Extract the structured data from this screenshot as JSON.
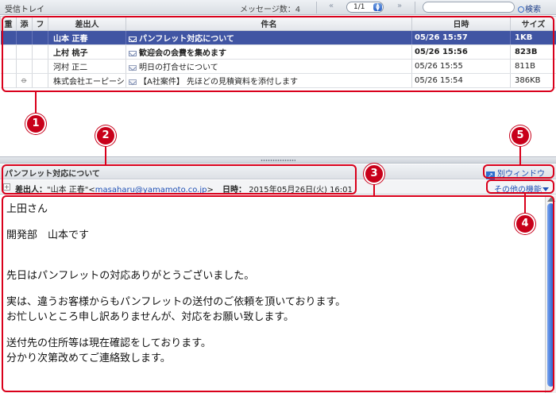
{
  "toolbar": {
    "title": "受信トレイ",
    "message_count": "メッセージ数：4",
    "page_prev": "«",
    "page_current": "1/1",
    "page_next": "»",
    "search_label": "検索",
    "search_placeholder": ""
  },
  "list": {
    "columns": [
      "重",
      "添",
      "フ",
      "差出人",
      "件名",
      "日時",
      "サイズ"
    ],
    "rows": [
      {
        "important": "",
        "attachment": false,
        "flag": "",
        "sender": "山本 正春",
        "subject": "パンフレット対応について",
        "date": "05/26 15:57",
        "size": "1KB",
        "state": "selected",
        "envelope": "read"
      },
      {
        "important": "",
        "attachment": false,
        "flag": "",
        "sender": "上村 桃子",
        "subject": "歓迎会の会費を集めます",
        "date": "05/26 15:56",
        "size": "823B",
        "state": "unread",
        "envelope": "unread"
      },
      {
        "important": "",
        "attachment": false,
        "flag": "",
        "sender": "河村 正二",
        "subject": "明日の打合せについて",
        "date": "05/26 15:55",
        "size": "811B",
        "state": "read",
        "envelope": "read"
      },
      {
        "important": "",
        "attachment": true,
        "flag": "",
        "sender": "株式会社エーピーシ",
        "subject": "【A社案件】 先ほどの見積資料を添付します",
        "date": "05/26 15:54",
        "size": "386KB",
        "state": "read",
        "envelope": "read"
      }
    ]
  },
  "preview": {
    "subject": "パンフレット対応について",
    "popout_label": "別ウィンドウ",
    "popout_icon": "popout-icon",
    "from_label": "差出人：",
    "from_name": "\"山本 正春\"",
    "from_email": "masaharu@yamamoto.co.jp",
    "date_label": "日時：",
    "date_value": "2015年05月26日(火) 16:01",
    "more_label": "その他の機能",
    "body": {
      "greeting": "上田さん",
      "intro": "開発部　山本です",
      "line1": "先日はパンフレットの対応ありがとうございました。",
      "line2": "実は、違うお客様からもパンフレットの送付のご依頼を頂いております。",
      "line3": "お忙しいところ申し訳ありませんが、対応をお願い致します。",
      "line4": "送付先の住所等は現在確認をしております。",
      "line5": "分かり次第改めてご連絡致します。"
    }
  },
  "callouts": {
    "c1": "1",
    "c2": "2",
    "c3": "3",
    "c4": "4",
    "c5": "5",
    "color": "#d9001b"
  },
  "colors": {
    "selected_row": "#4055a3",
    "link": "#1f4fb4"
  }
}
